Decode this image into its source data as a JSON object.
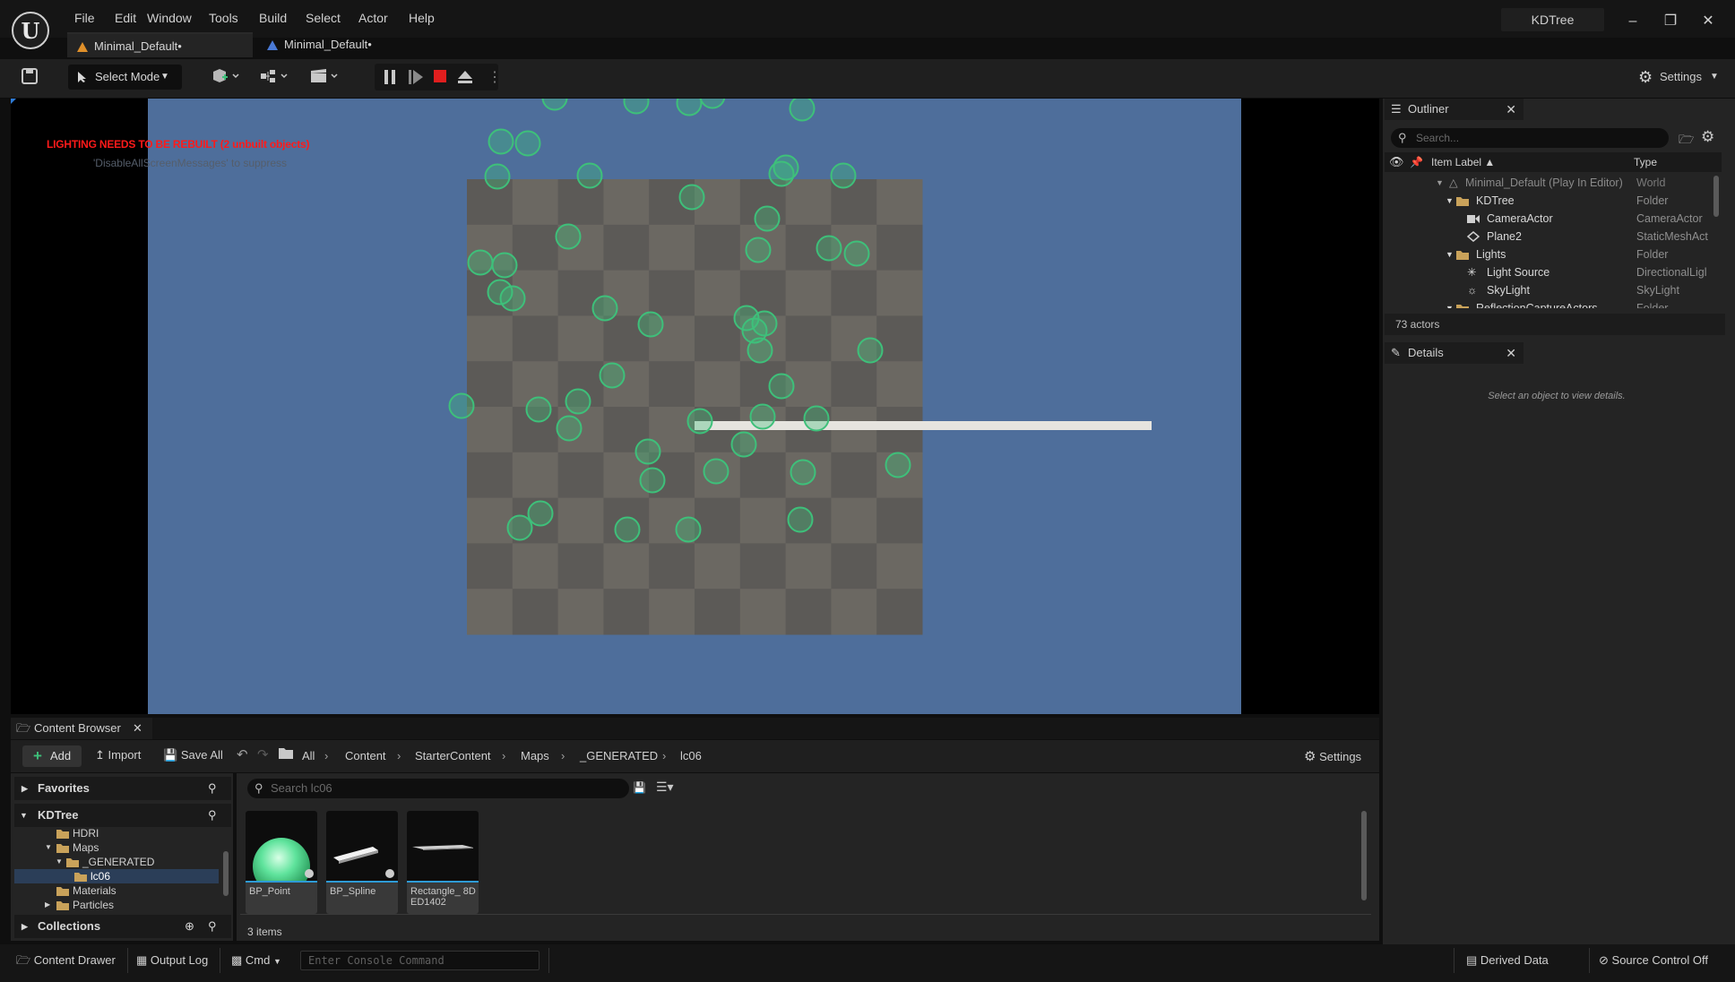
{
  "app": {
    "project_title": "KDTree",
    "menu": [
      "File",
      "Edit",
      "Window",
      "Tools",
      "Build",
      "Select",
      "Actor",
      "Help"
    ],
    "tabs": [
      {
        "label": "Minimal_Default•",
        "active": true
      },
      {
        "label": "Minimal_Default•",
        "active": false
      }
    ]
  },
  "toolbar": {
    "select_mode_label": "Select Mode",
    "settings_label": "Settings"
  },
  "viewport": {
    "warning": "LIGHTING NEEDS TO BE REBUILT (2 unbuilt objects)",
    "warning_sub": "'DisableAllScreenMessages' to suppress",
    "sky_color": "#4e6e9b",
    "checker_dark": "#5c5a57",
    "checker_light": "#6b6862",
    "sphere_color": "#3ec07a"
  },
  "outliner": {
    "title": "Outliner",
    "search_placeholder": "Search...",
    "col_label": "Item Label",
    "col_type": "Type",
    "rows": [
      {
        "label": "Minimal_Default (Play In Editor)",
        "type": "World",
        "icon": "world-icon"
      },
      {
        "label": "KDTree",
        "type": "Folder",
        "icon": "folder-icon"
      },
      {
        "label": "CameraActor",
        "type": "CameraActor",
        "icon": "camera-icon"
      },
      {
        "label": "Plane2",
        "type": "StaticMeshAct",
        "icon": "mesh-icon"
      },
      {
        "label": "Lights",
        "type": "Folder",
        "icon": "folder-icon"
      },
      {
        "label": "Light Source",
        "type": "DirectionalLigl",
        "icon": "light-icon"
      },
      {
        "label": "SkyLight",
        "type": "SkyLight",
        "icon": "skylight-icon"
      },
      {
        "label": "ReflectionCaptureActors",
        "type": "Folder",
        "icon": "folder-icon"
      }
    ],
    "actor_count": "73 actors"
  },
  "details": {
    "title": "Details",
    "empty_text": "Select an object to view details."
  },
  "content_browser": {
    "title": "Content Browser",
    "add_label": "Add",
    "import_label": "Import",
    "save_all_label": "Save All",
    "settings_label": "Settings",
    "breadcrumbs": [
      "All",
      "Content",
      "StarterContent",
      "Maps",
      "_GENERATED",
      "lc06"
    ],
    "favorites_label": "Favorites",
    "root_label": "KDTree",
    "tree": [
      "HDRI",
      "Maps",
      "_GENERATED",
      "lc06",
      "Materials",
      "Particles"
    ],
    "collections_label": "Collections",
    "search_placeholder": "Search lc06",
    "assets": [
      {
        "name": "BP_Point"
      },
      {
        "name": "BP_Spline"
      },
      {
        "name": "Rectangle_ 8DED1402"
      }
    ],
    "items_count": "3 items"
  },
  "statusbar": {
    "content_drawer": "Content Drawer",
    "output_log": "Output Log",
    "cmd": "Cmd",
    "console_placeholder": "Enter Console Command",
    "derived_data": "Derived Data",
    "source_control": "Source Control Off"
  }
}
